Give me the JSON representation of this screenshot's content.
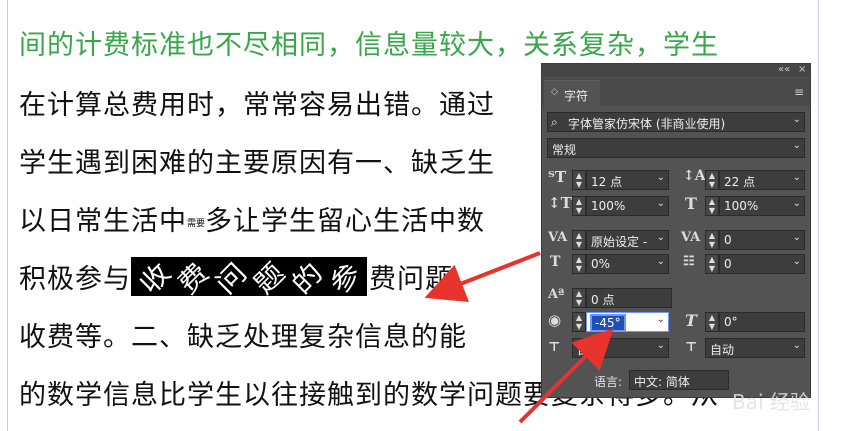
{
  "document": {
    "line1": "间的计费标准也不尽相同，信息量较大，关系复杂，学生",
    "line2": "在计算总费用时，常常容易出错。通过",
    "line3": "学生遇到困难的主要原因有一、缺乏生",
    "line4a": "以日常生活中",
    "line4small": "需要",
    "line4b": "多让学生留心生活中数",
    "line5a": "积极参与",
    "rotated_chars": [
      "收",
      "费",
      "问",
      "题",
      "的",
      "参"
    ],
    "line5b": "费问题，",
    "line6": "收费等。二、缺乏处理复杂信息的能",
    "line7": "的数学信息比学生以往接触到的数学问题要复杂得多。从"
  },
  "panel": {
    "panel_title": "字符",
    "font_family": "字体管家仿宋体 (非商业使用)",
    "font_style": "常规",
    "font_size": "12 点",
    "leading": "22 点",
    "vertical_scale": "100%",
    "horizontal_scale": "100%",
    "kerning": "原始设定 -",
    "tracking": "0",
    "baseline_shift_percent": "0%",
    "tsume": "0",
    "baseline_shift": "0 点",
    "character_rotation": "-45°",
    "skew": "0°",
    "auto_left": "自动",
    "auto_right": "自动",
    "language_label": "语言:",
    "language": "中文: 简体",
    "collapse_icon": "««",
    "close_icon": "×",
    "menu_icon": "≡"
  },
  "watermark": "Bai 经验"
}
